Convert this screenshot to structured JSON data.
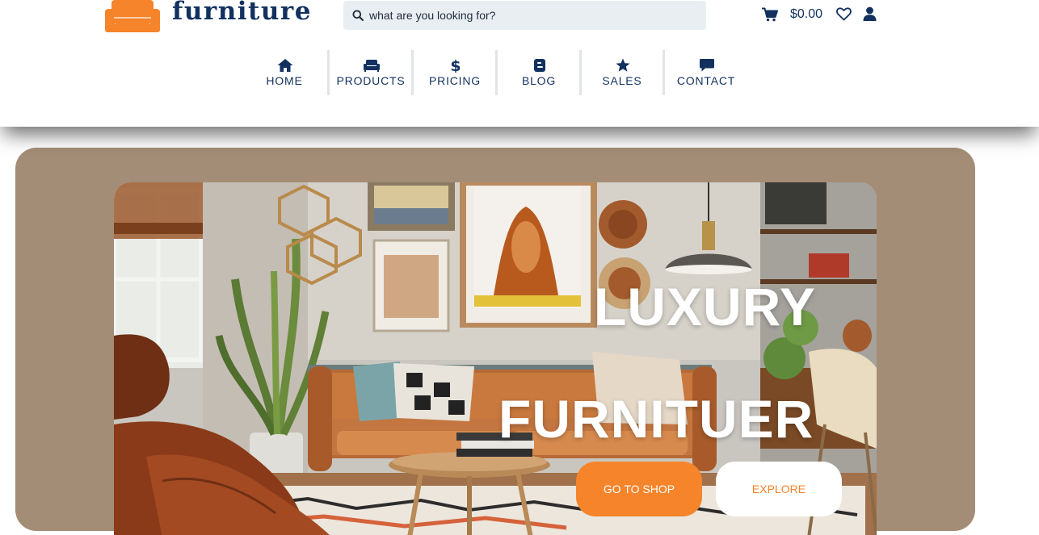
{
  "brand": {
    "name": "furniture",
    "logo_color": "#f5842b",
    "text_color": "#12315f"
  },
  "search": {
    "placeholder": "what are you looking for?",
    "value": "",
    "icon": "search-icon"
  },
  "header_actions": {
    "cart_icon": "cart-icon",
    "cart_total": "$0.00",
    "wishlist_icon": "heart-icon",
    "account_icon": "user-icon"
  },
  "nav": {
    "items": [
      {
        "label": "HOME",
        "icon": "home-icon"
      },
      {
        "label": "PRODUCTS",
        "icon": "sofa-icon"
      },
      {
        "label": "PRICING",
        "icon": "dollar-icon"
      },
      {
        "label": "BLOG",
        "icon": "blogger-icon"
      },
      {
        "label": "SALES",
        "icon": "star-icon"
      },
      {
        "label": "CONTACT",
        "icon": "chat-icon"
      }
    ]
  },
  "hero": {
    "title_line1": "LUXURY",
    "title_line2": "FURNITUER",
    "primary_button": "GO TO SHOP",
    "secondary_button": "EXPLORE",
    "card_color": "#a48d76",
    "accent_color": "#f5842b"
  }
}
